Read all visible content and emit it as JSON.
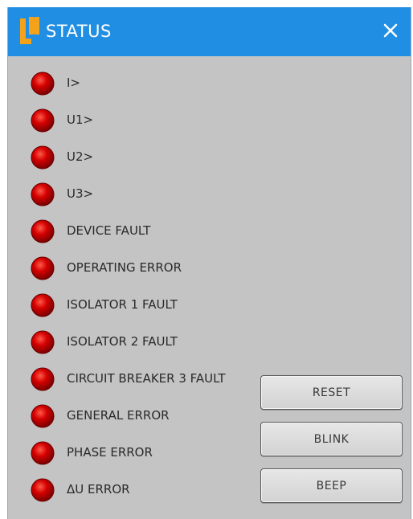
{
  "window": {
    "title": "STATUS",
    "logo_icon": "ln-logo",
    "close_icon": "close-icon",
    "colors": {
      "titlebar": "#1f8ee3",
      "logo": "#f5a21b",
      "led": "#c80000",
      "panel": "#c4c4c4"
    }
  },
  "status_items": [
    {
      "label": "I>",
      "state": "red"
    },
    {
      "label": "U1>",
      "state": "red"
    },
    {
      "label": "U2>",
      "state": "red"
    },
    {
      "label": "U3>",
      "state": "red"
    },
    {
      "label": "DEVICE FAULT",
      "state": "red"
    },
    {
      "label": "OPERATING ERROR",
      "state": "red"
    },
    {
      "label": "ISOLATOR 1 FAULT",
      "state": "red"
    },
    {
      "label": "ISOLATOR 2 FAULT",
      "state": "red"
    },
    {
      "label": "CIRCUIT BREAKER 3 FAULT",
      "state": "red"
    },
    {
      "label": "GENERAL ERROR",
      "state": "red"
    },
    {
      "label": "PHASE ERROR",
      "state": "red"
    },
    {
      "label": "ΔU ERROR",
      "state": "red"
    }
  ],
  "buttons": {
    "reset_label": "RESET",
    "blink_label": "BLINK",
    "beep_label": "BEEP"
  }
}
